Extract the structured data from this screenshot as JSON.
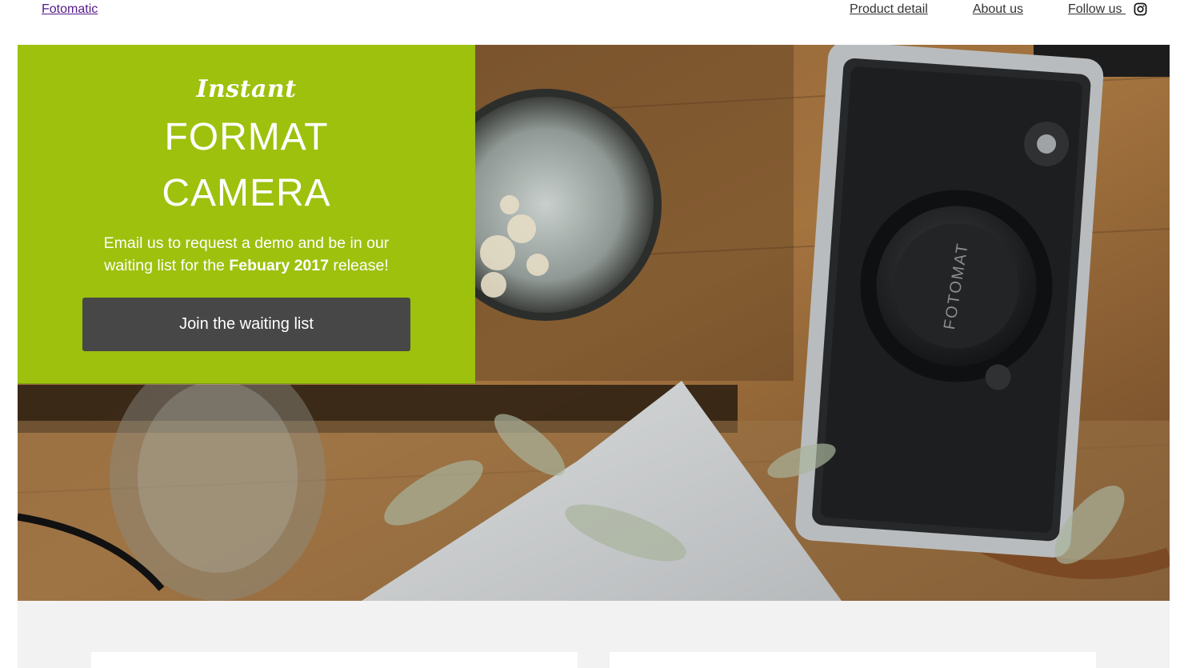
{
  "nav": {
    "brand": "Fotomatic",
    "links": [
      "Product detail",
      "About us",
      "Follow us "
    ],
    "social_icon": "instagram-icon"
  },
  "hero": {
    "eyebrow": "Instant",
    "title_line1": "FORMAT",
    "title_line2": "CAMERA",
    "blurb_pre": "Email us to request a demo and be in our waiting list for the ",
    "blurb_bold": "Febuary 2017",
    "blurb_post": " release!",
    "cta_label": "Join the waiting list",
    "camera_cap_text": "FOTOMAT",
    "accent_color": "#9dc10d",
    "button_color": "#474747"
  },
  "lower": {
    "background": "#f2f2f2"
  }
}
